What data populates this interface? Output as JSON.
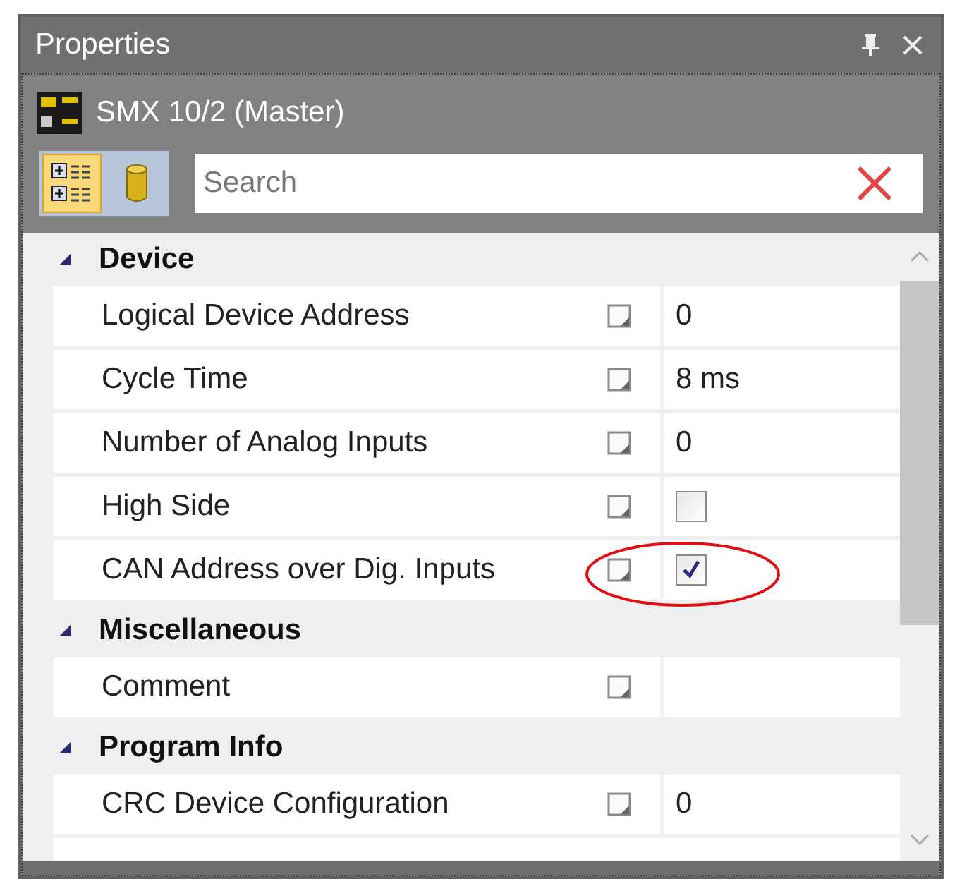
{
  "panel": {
    "title": "Properties"
  },
  "device": {
    "name": "SMX 10/2 (Master)"
  },
  "view_buttons": [
    {
      "kind": "categorized",
      "selected": true
    },
    {
      "kind": "database",
      "selected": false
    }
  ],
  "search": {
    "placeholder": "Search"
  },
  "categories": [
    {
      "name": "Device",
      "expanded": true,
      "properties": [
        {
          "name": "Logical Device Address",
          "kind": "text",
          "value": "0",
          "highlighted": false
        },
        {
          "name": "Cycle Time",
          "kind": "text",
          "value": "8 ms",
          "highlighted": false
        },
        {
          "name": "Number of Analog Inputs",
          "kind": "text",
          "value": "0",
          "highlighted": false
        },
        {
          "name": "High Side",
          "kind": "checkbox",
          "checked": false,
          "highlighted": false
        },
        {
          "name": "CAN Address over Dig. Inputs",
          "kind": "checkbox",
          "checked": true,
          "highlighted": true
        }
      ]
    },
    {
      "name": "Miscellaneous",
      "expanded": true,
      "properties": [
        {
          "name": "Comment",
          "kind": "text",
          "highlighted": false
        }
      ]
    },
    {
      "name": "Program Info",
      "expanded": true,
      "properties": [
        {
          "name": "CRC Device Configuration",
          "kind": "text",
          "value": "0",
          "highlighted": false
        }
      ]
    }
  ]
}
